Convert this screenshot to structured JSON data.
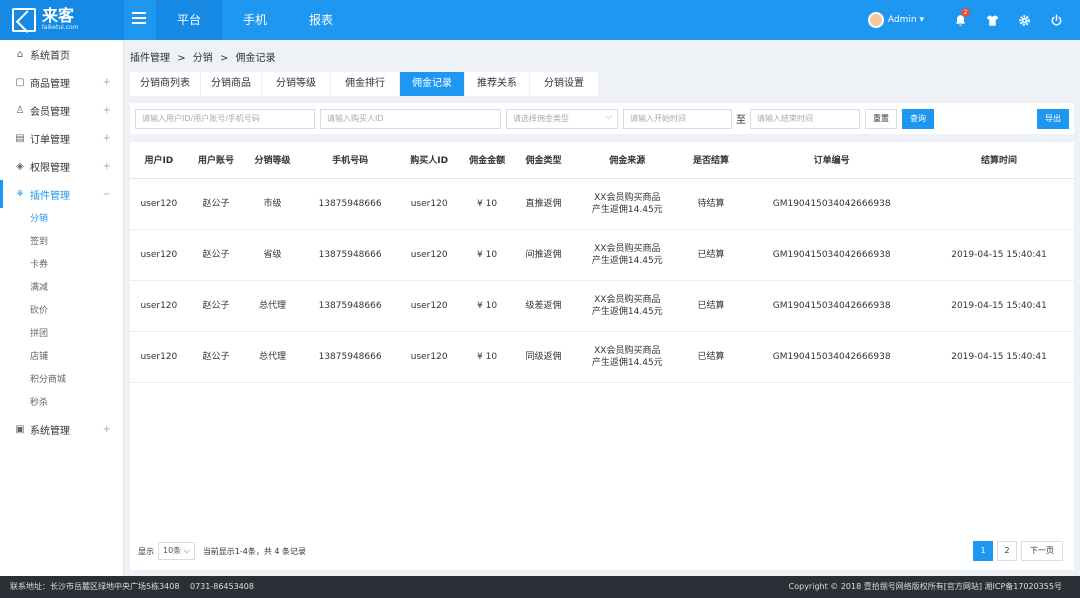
{
  "app": {
    "logo_text": "来客",
    "logo_sub": "laiketui.com"
  },
  "topnav": {
    "items": [
      "平台",
      "手机",
      "报表"
    ]
  },
  "user": {
    "name": "Admin",
    "notification_count": "2"
  },
  "sidebar": {
    "items": [
      {
        "label": "系统首页",
        "icon": "home-icon"
      },
      {
        "label": "商品管理",
        "icon": "box-icon"
      },
      {
        "label": "会员管理",
        "icon": "users-icon"
      },
      {
        "label": "订单管理",
        "icon": "order-icon"
      },
      {
        "label": "权限管理",
        "icon": "shield-icon"
      },
      {
        "label": "插件管理",
        "icon": "plugin-icon"
      },
      {
        "label": "系统管理",
        "icon": "monitor-icon"
      }
    ],
    "plugin_subitems": [
      "分销",
      "签到",
      "卡券",
      "满减",
      "砍价",
      "拼团",
      "店铺",
      "积分商城",
      "秒杀"
    ]
  },
  "breadcrumb": {
    "a": "插件管理",
    "sep": ">",
    "b": "分销",
    "c": "佣金记录"
  },
  "tabs": [
    "分销商列表",
    "分销商品",
    "分销等级",
    "佣金排行",
    "佣金记录",
    "推荐关系",
    "分销设置"
  ],
  "filters": {
    "user_placeholder": "请输入用户ID/用户账号/手机号码",
    "buyer_placeholder": "请输入购买人ID",
    "type_placeholder": "请选择佣金类型",
    "start_placeholder": "请输入开始时间",
    "to_label": "至",
    "end_placeholder": "请输入结束时间",
    "reset_label": "重置",
    "query_label": "查询",
    "export_label": "导出"
  },
  "table": {
    "headers": [
      "用户ID",
      "用户账号",
      "分销等级",
      "手机号码",
      "购买人ID",
      "佣金金额",
      "佣金类型",
      "佣金来源",
      "是否结算",
      "订单编号",
      "结算时间"
    ],
    "rows": [
      [
        "user120",
        "赵公子",
        "市级",
        "13875948666",
        "user120",
        "¥ 10",
        "直推返佣",
        "XX会员购买商品|产生返佣14.45元",
        "待结算",
        "GM190415034042666938",
        ""
      ],
      [
        "user120",
        "赵公子",
        "省级",
        "13875948666",
        "user120",
        "¥ 10",
        "间推返佣",
        "XX会员购买商品|产生返佣14.45元",
        "已结算",
        "GM190415034042666938",
        "2019-04-15 15:40:41"
      ],
      [
        "user120",
        "赵公子",
        "总代理",
        "13875948666",
        "user120",
        "¥ 10",
        "级差返佣",
        "XX会员购买商品|产生返佣14.45元",
        "已结算",
        "GM190415034042666938",
        "2019-04-15 15:40:41"
      ],
      [
        "user120",
        "赵公子",
        "总代理",
        "13875948666",
        "user120",
        "¥ 10",
        "同级返佣",
        "XX会员购买商品|产生返佣14.45元",
        "已结算",
        "GM190415034042666938",
        "2019-04-15 15:40:41"
      ]
    ]
  },
  "pager": {
    "show_label": "显示",
    "page_size": "10条",
    "summary": "当前显示1-4条，共 4 条记录",
    "pages": [
      "1",
      "2"
    ],
    "next_label": "下一页"
  },
  "footer": {
    "left": "联系地址：长沙市岳麓区绿地中央广场5栋3408　 0731-86453408",
    "right": "Copyright © 2018 壹拾捌号网络版权所有[官方网站]  湘ICP备17020355号"
  },
  "colors": {
    "primary": "#1e97f0",
    "footer": "#2b2f36"
  }
}
